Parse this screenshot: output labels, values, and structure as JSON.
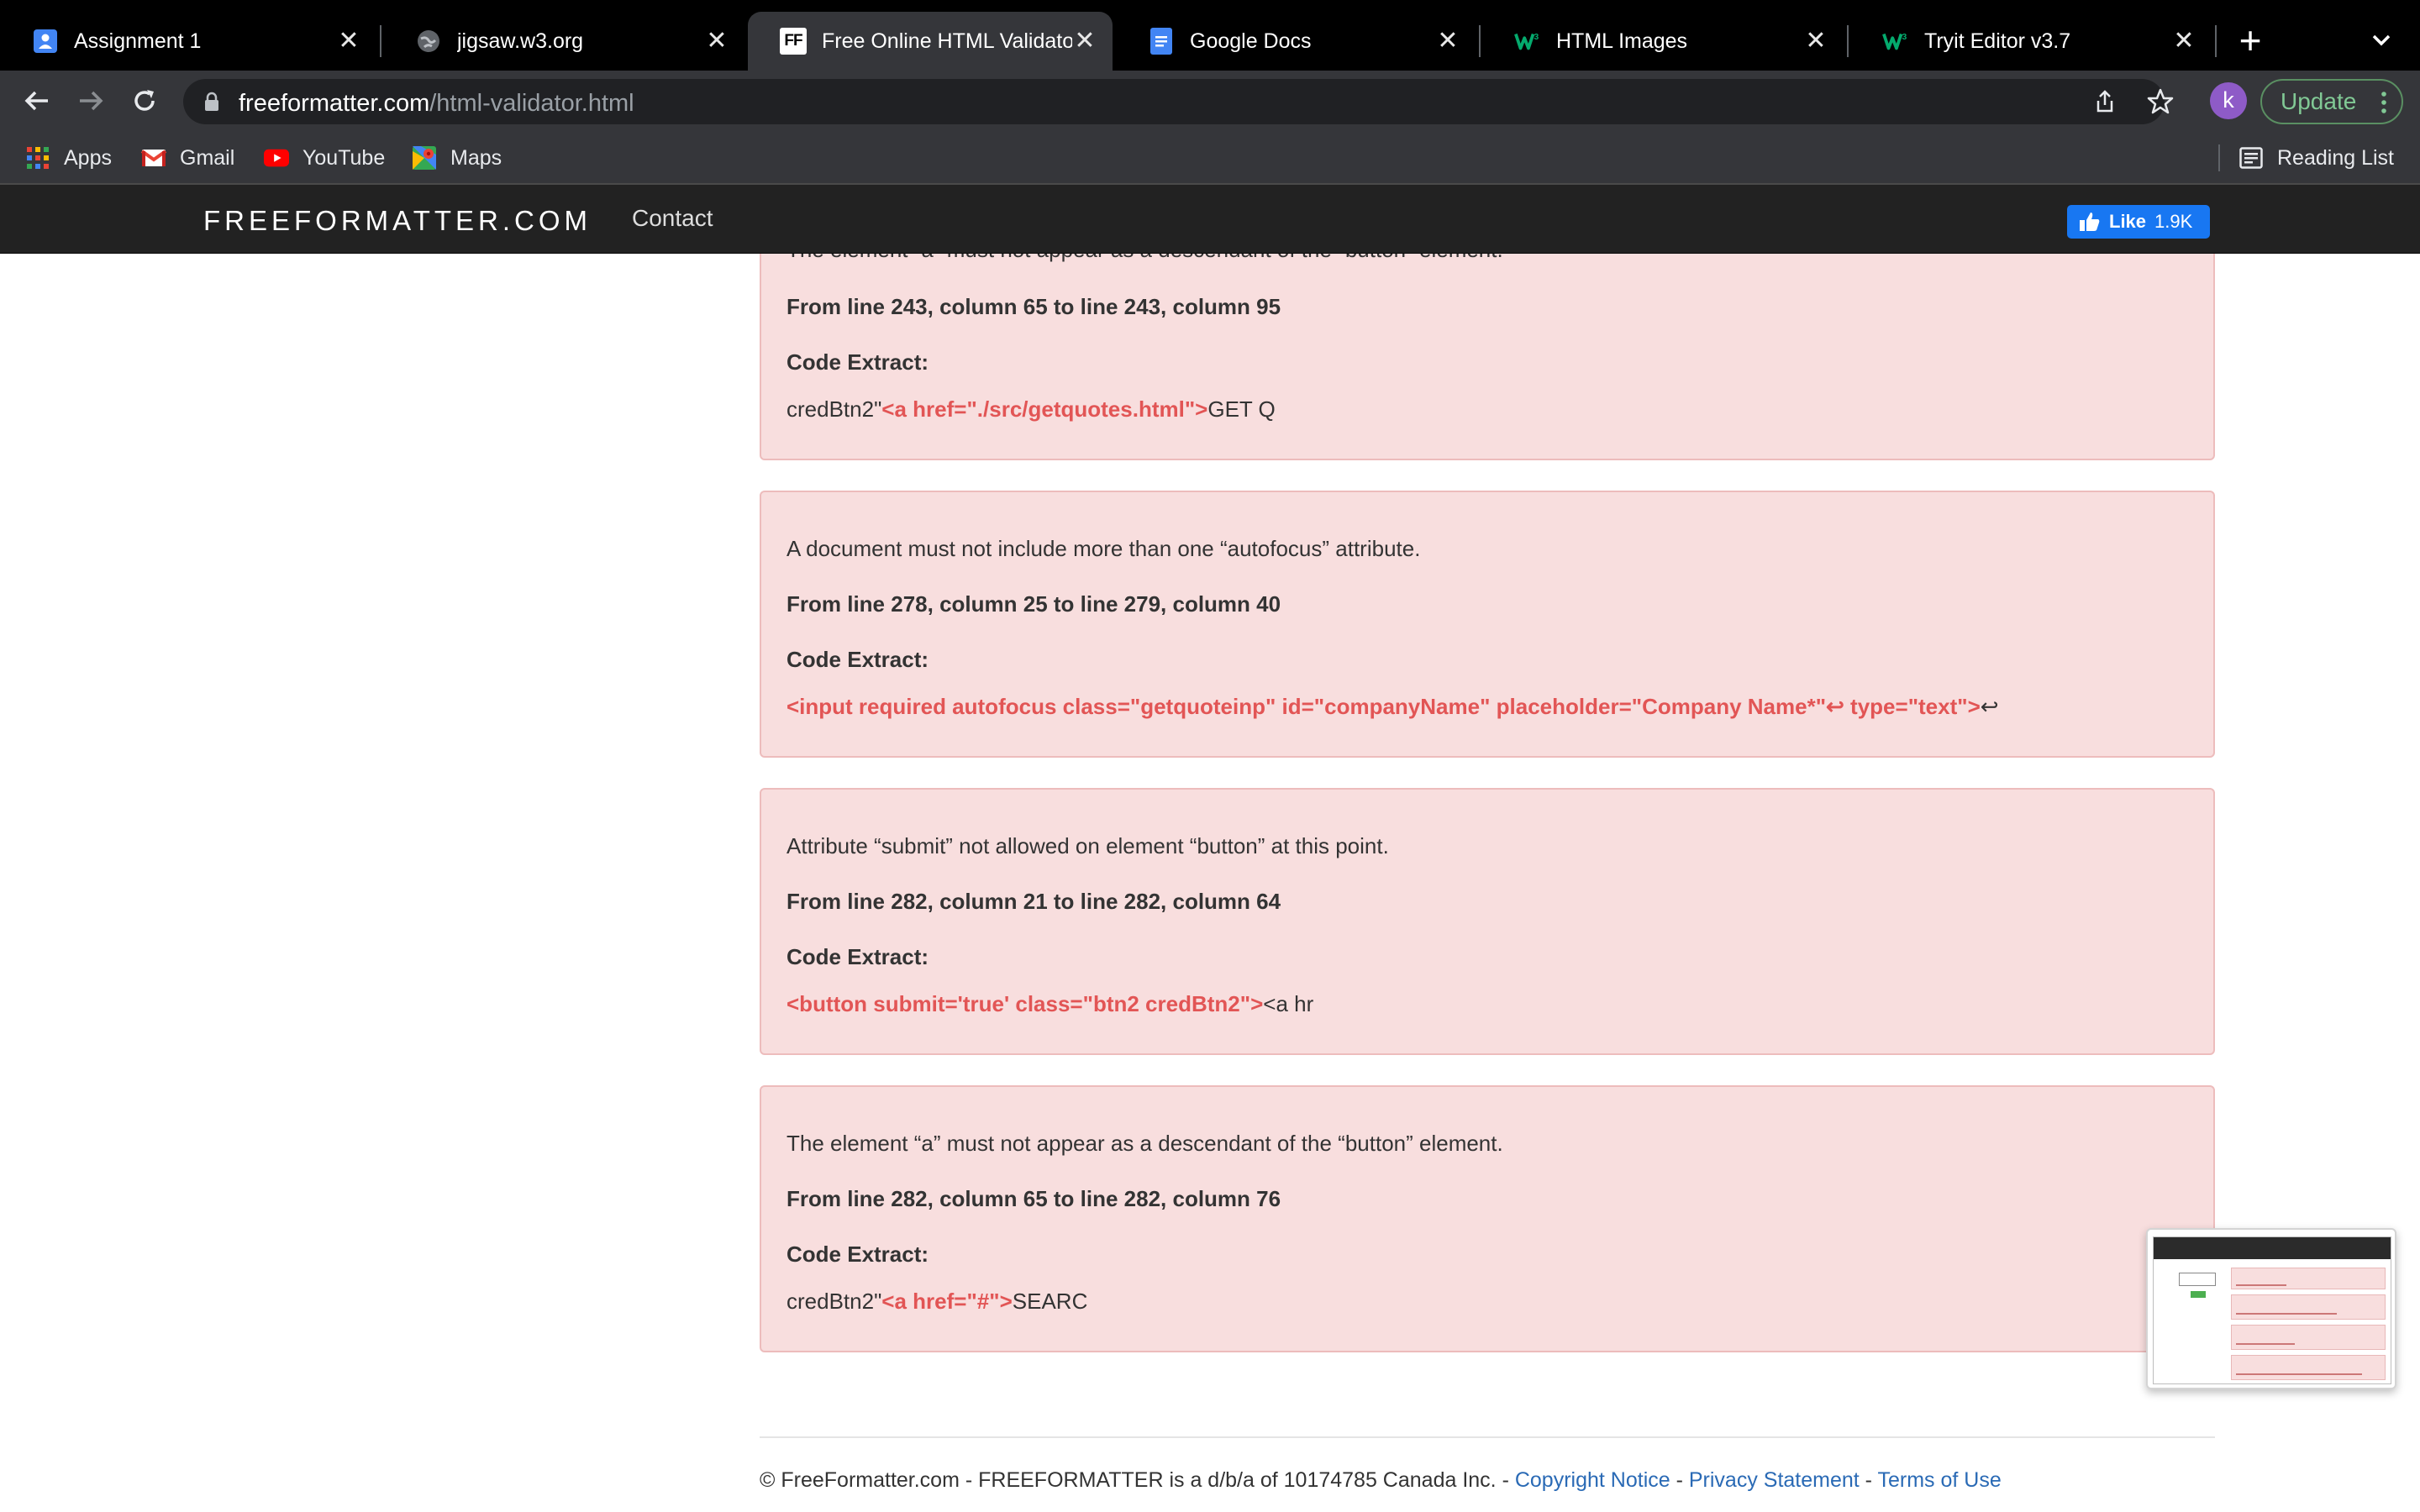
{
  "browser": {
    "tabs": [
      {
        "title": "Assignment 1",
        "icon": "classroom-icon",
        "active": false
      },
      {
        "title": "jigsaw.w3.org",
        "icon": "globe-icon",
        "active": false
      },
      {
        "title": "Free Online HTML Validator",
        "icon": "freeformatter-icon",
        "active": true
      },
      {
        "title": "Google Docs",
        "icon": "docs-icon",
        "active": false
      },
      {
        "title": "HTML Images",
        "icon": "w3schools-icon",
        "active": false
      },
      {
        "title": "Tryit Editor v3.7",
        "icon": "w3schools-icon",
        "active": false
      }
    ],
    "ff_favicon_text": "FF",
    "url_host": "freeformatter.com",
    "url_path": "/html-validator.html",
    "profile_initial": "k",
    "update_label": "Update",
    "bookmarks": [
      {
        "label": "Apps",
        "icon": "apps-grid-icon"
      },
      {
        "label": "Gmail",
        "icon": "gmail-icon"
      },
      {
        "label": "YouTube",
        "icon": "youtube-icon"
      },
      {
        "label": "Maps",
        "icon": "maps-icon"
      }
    ],
    "reading_list_label": "Reading List"
  },
  "site": {
    "brand": "FREEFORMATTER.COM",
    "nav_contact": "Contact",
    "like_label": "Like",
    "like_count": "1.9K"
  },
  "errors": [
    {
      "message": "The element “a” must not appear as a descendant of the “button” element.",
      "location": "From line 243, column 65 to line 243, column 95",
      "code_label": "Code Extract:",
      "code_pre": "credBtn2\"",
      "code_hl": "<a href=\"./src/getquotes.html\">",
      "code_post": "GET Q"
    },
    {
      "message": "A document must not include more than one “autofocus” attribute.",
      "location": "From line 278, column 25 to line 279, column 40",
      "code_label": "Code Extract:",
      "code_hl": "<input required autofocus class=\"getquoteinp\" id=\"companyName\" placeholder=\"Company Name*\"",
      "code_ret": "↩",
      "code_hl2": " type=\"text\">",
      "code_post": "↩"
    },
    {
      "message": "Attribute “submit” not allowed on element “button” at this point.",
      "location": "From line 282, column 21 to line 282, column 64",
      "code_label": "Code Extract:",
      "code_hl": "<button submit='true' class=\"btn2 credBtn2\">",
      "code_post": "<a hr"
    },
    {
      "message": "The element “a” must not appear as a descendant of the “button” element.",
      "location": "From line 282, column 65 to line 282, column 76",
      "code_label": "Code Extract:",
      "code_pre": "credBtn2\"",
      "code_hl": "<a href=\"#\">",
      "code_post": "SEARC"
    }
  ],
  "footer": {
    "copyright": "© FreeFormatter.com - FREEFORMATTER is a d/b/a of 10174785 Canada Inc. - ",
    "link1": "Copyright Notice",
    "sep": " - ",
    "link2": "Privacy Statement",
    "link3": "Terms of Use"
  },
  "colors": {
    "error_bg": "#f8dede",
    "error_border": "#edbcbc",
    "code_highlight": "#e25555",
    "header_bg": "#222222",
    "facebook_blue": "#1877f2"
  }
}
